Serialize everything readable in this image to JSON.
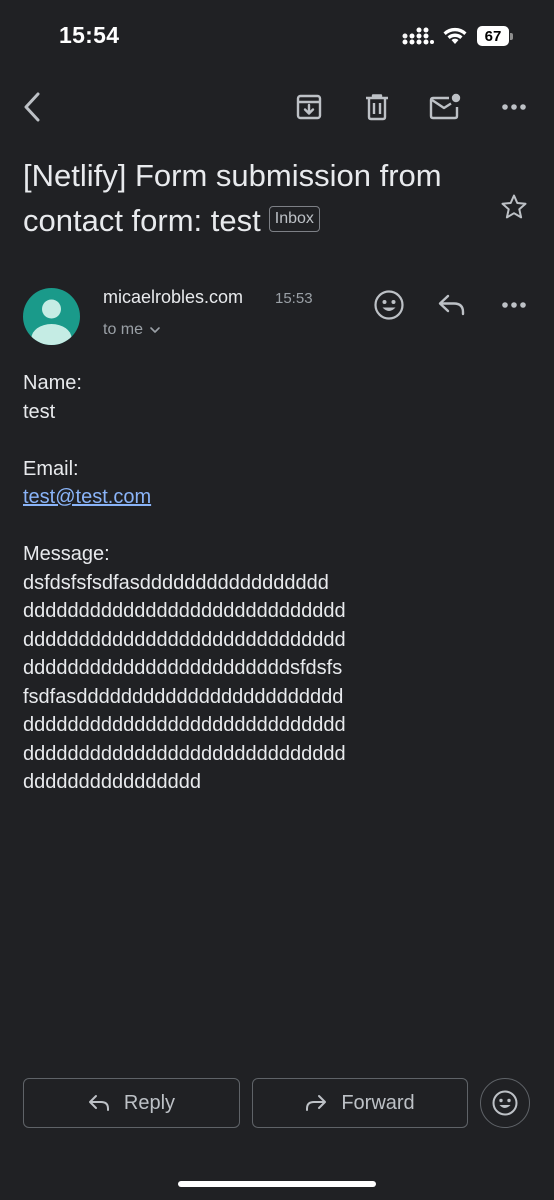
{
  "status_bar": {
    "time": "15:54",
    "battery": "67",
    "icons": [
      "signal-icon",
      "wifi-icon",
      "battery-icon"
    ]
  },
  "toolbar": {
    "icons": [
      "back-arrow-icon",
      "archive-icon",
      "trash-icon",
      "mark-unread-icon",
      "more-vert-icon"
    ]
  },
  "email": {
    "subject": "[Netlify] Form submission from contact form: test",
    "label_chip": "Inbox",
    "sender": "micaelrobles.com",
    "time": "15:53",
    "recipient": "to me",
    "body": {
      "name_label": "Name:",
      "name_value": "test",
      "email_label": "Email:",
      "email_value": "test@test.com",
      "message_label": "Message:",
      "message_lines": [
        "dsfdsfsfsdfasddddddddddddddddd",
        "ddddddddddddddddddddddddddddd",
        "ddddddddddddddddddddddddddddd",
        "ddddddddddddddddddddddddsfdsfs",
        "fsdfasdddddddddddddddddddddddd",
        "ddddddddddddddddddddddddddddd",
        "ddddddddddddddddddddddddddddd",
        "dddddddddddddddd"
      ]
    }
  },
  "actions": {
    "reply": "Reply",
    "forward": "Forward"
  },
  "colors": {
    "background": "#202124",
    "text": "#e8eaed",
    "secondary": "#9aa0a6",
    "link": "#8ab4f8",
    "avatar": "#1a9a8a"
  }
}
